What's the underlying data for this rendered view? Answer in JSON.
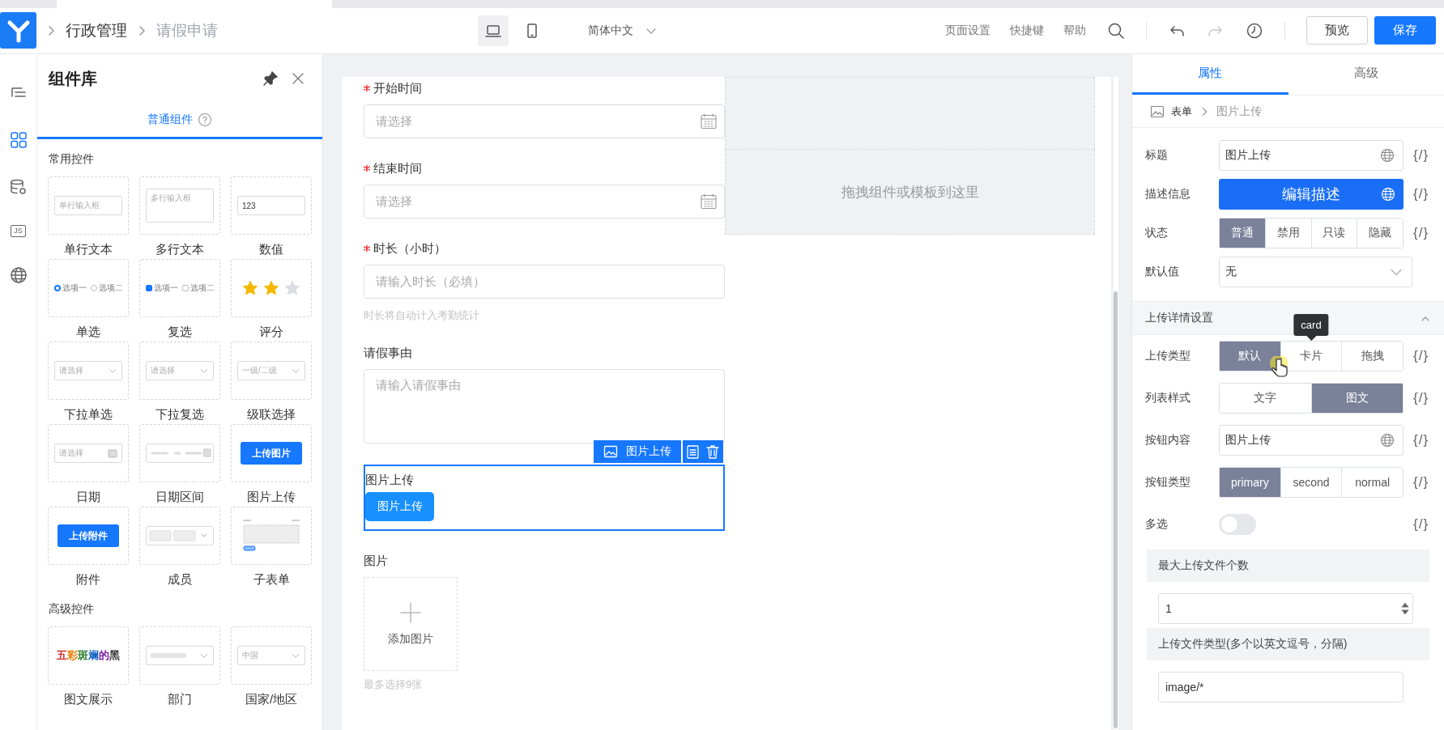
{
  "top_bar": {
    "breadcrumb": [
      {
        "label": "行政管理",
        "current": false
      },
      {
        "label": "请假申请",
        "current": true
      }
    ],
    "devices": [
      {
        "kind": "desktop",
        "selected": true
      },
      {
        "kind": "mobile",
        "selected": false
      }
    ],
    "language": "简体中文",
    "links": [
      "页面设置",
      "快捷键",
      "帮助"
    ],
    "tools": [
      {
        "kind": "undo",
        "disabled": false
      },
      {
        "kind": "redo",
        "disabled": true
      },
      {
        "kind": "history",
        "disabled": false
      }
    ],
    "preview": "预览",
    "save": "保存"
  },
  "rail": [
    {
      "kind": "outline",
      "selected": false
    },
    {
      "kind": "components",
      "selected": true
    },
    {
      "kind": "data",
      "selected": false
    },
    {
      "kind": "js",
      "label": "JS",
      "selected": false
    },
    {
      "kind": "globe",
      "selected": false
    }
  ],
  "library": {
    "title": "组件库",
    "tab": {
      "label": "普通组件",
      "selected": true
    },
    "sections": [
      {
        "title": "常用控件",
        "items": [
          {
            "label": "单行文本",
            "kind": "input",
            "preview": "单行输入框"
          },
          {
            "label": "多行文本",
            "kind": "textarea",
            "preview": "多行输入框"
          },
          {
            "label": "数值",
            "kind": "number",
            "preview": "123"
          },
          {
            "label": "单选",
            "kind": "radio",
            "options": [
              {
                "label": "选项一",
                "checked": true
              },
              {
                "label": "选项二",
                "checked": false
              }
            ]
          },
          {
            "label": "复选",
            "kind": "checkbox",
            "options": [
              {
                "label": "选项一",
                "checked": true
              },
              {
                "label": "选项二",
                "checked": false
              }
            ]
          },
          {
            "label": "评分",
            "kind": "rating",
            "stars": 2
          },
          {
            "label": "下拉单选",
            "kind": "select",
            "preview": "请选择"
          },
          {
            "label": "下拉复选",
            "kind": "select",
            "preview": "请选择"
          },
          {
            "label": "级联选择",
            "kind": "select",
            "preview": "一级/二级"
          },
          {
            "label": "日期",
            "kind": "date",
            "preview": "请选择"
          },
          {
            "label": "日期区间",
            "kind": "daterange"
          },
          {
            "label": "图片上传",
            "kind": "button",
            "preview": "上传图片"
          },
          {
            "label": "附件",
            "kind": "button",
            "preview": "上传附件"
          },
          {
            "label": "成员",
            "kind": "members"
          },
          {
            "label": "子表单",
            "kind": "subform"
          }
        ]
      },
      {
        "title": "高级控件",
        "items": [
          {
            "label": "图文展示",
            "kind": "richtext",
            "preview": "五彩斑斓的黑"
          },
          {
            "label": "部门",
            "kind": "select"
          },
          {
            "label": "国家/地区",
            "kind": "select",
            "preview": "中国"
          }
        ]
      }
    ]
  },
  "form": {
    "fields": [
      {
        "kind": "date",
        "label": "开始时间",
        "required": true,
        "selected": false,
        "placeholder": "请选择"
      },
      {
        "kind": "date",
        "label": "结束时间",
        "required": true,
        "selected": false,
        "placeholder": "请选择"
      },
      {
        "kind": "input",
        "label": "时长（小时）",
        "required": true,
        "selected": false,
        "placeholder": "请输入时长（必填）",
        "hint": "时长将自动计入考勤统计"
      },
      {
        "kind": "textarea",
        "label": "请假事由",
        "required": false,
        "selected": false,
        "placeholder": "请输入请假事由"
      },
      {
        "kind": "upload",
        "label": "图片上传",
        "required": false,
        "selected": true,
        "toolbar_label": "图片上传",
        "button": "图片上传"
      },
      {
        "kind": "image",
        "label": "图片",
        "required": false,
        "selected": false,
        "add_label": "添加图片",
        "hint": "最多选择9张"
      }
    ],
    "drop_hint": "拖拽组件或模板到这里"
  },
  "properties": {
    "tabs": [
      {
        "label": "属性",
        "selected": true
      },
      {
        "label": "高级",
        "selected": false
      }
    ],
    "breadcrumb": [
      {
        "label": "表单",
        "current": false
      },
      {
        "label": "图片上传",
        "current": true
      }
    ],
    "rows": [
      {
        "kind": "text",
        "label": "标题",
        "value": "图片上传",
        "code": "{/}"
      },
      {
        "kind": "action",
        "label": "描述信息",
        "value": "编辑描述",
        "code": "{/}"
      },
      {
        "kind": "segmented",
        "label": "状态",
        "options": [
          {
            "label": "普通",
            "selected": true
          },
          {
            "label": "禁用",
            "selected": false
          },
          {
            "label": "只读",
            "selected": false
          },
          {
            "label": "隐藏",
            "selected": false
          }
        ],
        "code": "{/}"
      },
      {
        "kind": "select",
        "label": "默认值",
        "value": "无"
      }
    ],
    "section": {
      "title": "上传详情设置",
      "expanded": true,
      "rows": [
        {
          "kind": "segmented",
          "label": "上传类型",
          "options": [
            {
              "label": "默认",
              "selected": true
            },
            {
              "label": "卡片",
              "selected": false,
              "tooltip": "card"
            },
            {
              "label": "拖拽",
              "selected": false
            }
          ],
          "code": "{/}"
        },
        {
          "kind": "segmented",
          "label": "列表样式",
          "options": [
            {
              "label": "文字",
              "selected": false
            },
            {
              "label": "图文",
              "selected": true
            }
          ],
          "code": "{/}"
        },
        {
          "kind": "text",
          "label": "按钮内容",
          "value": "图片上传",
          "code": "{/}"
        },
        {
          "kind": "segmented",
          "label": "按钮类型",
          "options": [
            {
              "label": "primary",
              "selected": true
            },
            {
              "label": "second",
              "selected": false
            },
            {
              "label": "normal",
              "selected": false
            }
          ],
          "code": "{/}"
        },
        {
          "kind": "toggle",
          "label": "多选",
          "on": false,
          "code": "{/}"
        },
        {
          "kind": "number_block",
          "label": "最大上传文件个数",
          "value": "1"
        },
        {
          "kind": "text_block",
          "label": "上传文件类型(多个以英文逗号，分隔)",
          "value": "image/*"
        }
      ]
    }
  }
}
